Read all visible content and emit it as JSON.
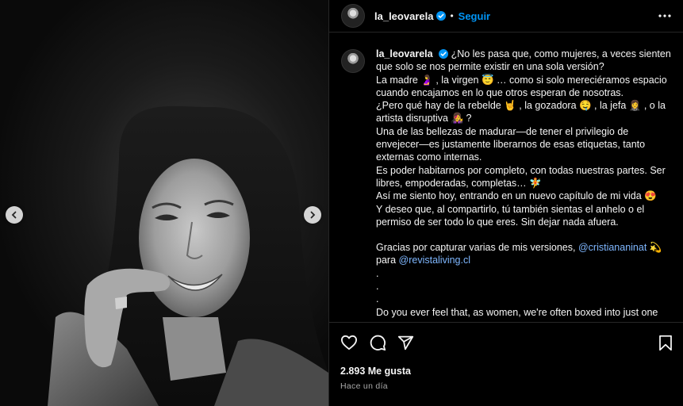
{
  "post": {
    "username": "la_leovarela",
    "separator": "•",
    "follow_label": "Seguir",
    "photo_alt_icon": "portrait-photo"
  },
  "caption": {
    "username": "la_leovarela",
    "lines": [
      "¿No les pasa que, como mujeres, a veces sienten que solo se nos permite existir en una sola versión?",
      "La madre 🤰 , la virgen 😇 … como si solo mereciéramos espacio cuando encajamos en lo que otros esperan de nosotras.",
      "¿Pero qué hay de la rebelde 🤘 , la gozadora 🤤 , la jefa 🤵‍♀️ , o la artista disruptiva 👩‍🎤 ?",
      "Una de las bellezas de madurar—de tener el privilegio de envejecer—es justamente liberarnos de esas etiquetas, tanto externas como internas.",
      "Es poder habitarnos por completo, con todas nuestras partes. Ser libres, empoderadas, completas… 🧚",
      "Así me siento hoy, entrando en un nuevo capítulo de mi vida 😍",
      "Y deseo que, al compartirlo, tú también sientas el anhelo o el permiso de ser todo lo que eres. Sin dejar nada afuera."
    ],
    "credits_prefix": "Gracias por capturar varias de mis versiones,",
    "mention_1": "@cristiananinat",
    "credits_emoji": "💫",
    "credits_para": "para",
    "mention_2": "@revistaliving.cl",
    "dots": [
      ".",
      ".",
      "."
    ],
    "english_start": "Do you ever feel that, as women, we're often boxed into just one"
  },
  "footer": {
    "likes": "2.893 Me gusta",
    "time": "Hace un día"
  },
  "colors": {
    "accent": "#0095f6",
    "background": "#000000",
    "text": "#f5f5f5",
    "muted": "#a8a8a8",
    "mention": "#7fb7ff"
  },
  "icons": [
    "more-options-icon",
    "verified-badge-icon",
    "heart-icon",
    "comment-icon",
    "share-icon",
    "bookmark-icon",
    "chevron-left-icon",
    "chevron-right-icon"
  ]
}
